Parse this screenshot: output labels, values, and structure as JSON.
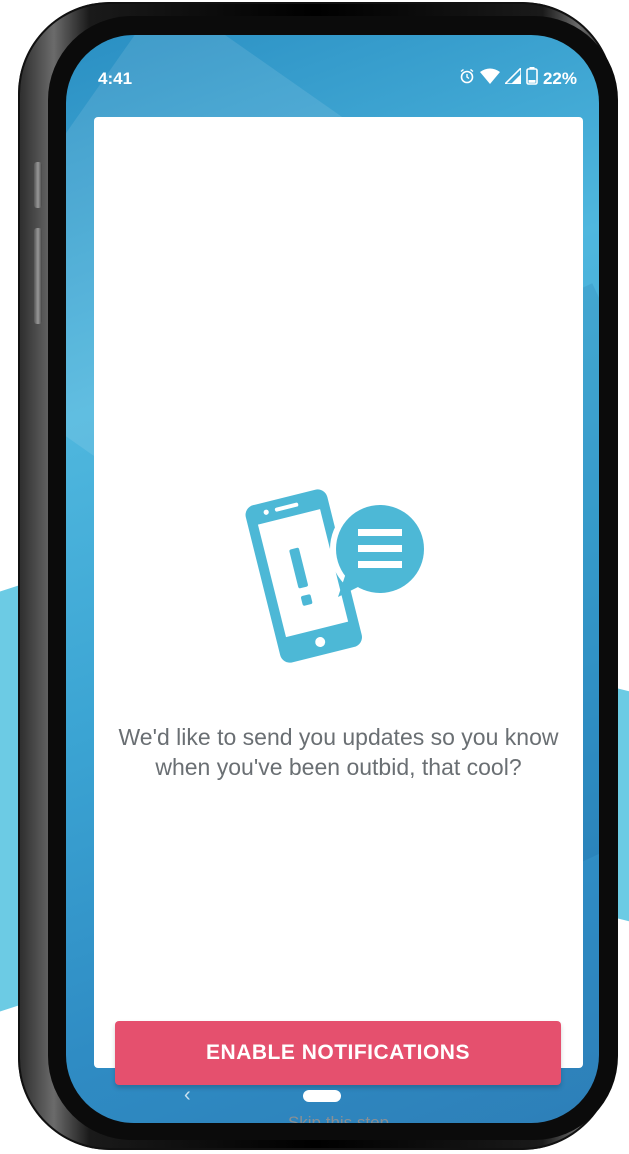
{
  "status_bar": {
    "time": "4:41",
    "battery": "22%",
    "icons": [
      "alarm-icon",
      "wifi-icon",
      "signal-icon",
      "battery-icon"
    ]
  },
  "card": {
    "message": "We'd like to send you updates so you know when you've been outbid, that cool?",
    "enable_button_label": "ENABLE NOTIFICATIONS",
    "skip_label": "Skip this step",
    "illustration_icon": "phone-notification-icon"
  },
  "nav_bar": {
    "back_icon": "chevron-left-icon",
    "home_icon": "home-pill-icon"
  },
  "colors": {
    "accent": "#e5506e",
    "illustration": "#4db8d6",
    "screen_background": "#3ba4d3",
    "text_gray": "#6a6f73"
  }
}
